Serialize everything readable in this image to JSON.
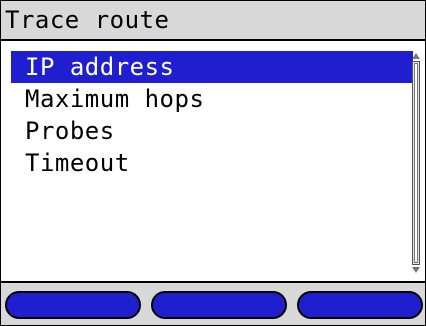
{
  "title": "Trace route",
  "menu": {
    "items": [
      {
        "label": "IP address",
        "selected": true
      },
      {
        "label": "Maximum hops",
        "selected": false
      },
      {
        "label": "Probes",
        "selected": false
      },
      {
        "label": "Timeout",
        "selected": false
      }
    ]
  },
  "softkeys": [
    {
      "label": ""
    },
    {
      "label": ""
    },
    {
      "label": ""
    }
  ],
  "colors": {
    "selection": "#1f1fd0",
    "softkey": "#1f1fd0",
    "bar_background": "#d8d8d8"
  }
}
